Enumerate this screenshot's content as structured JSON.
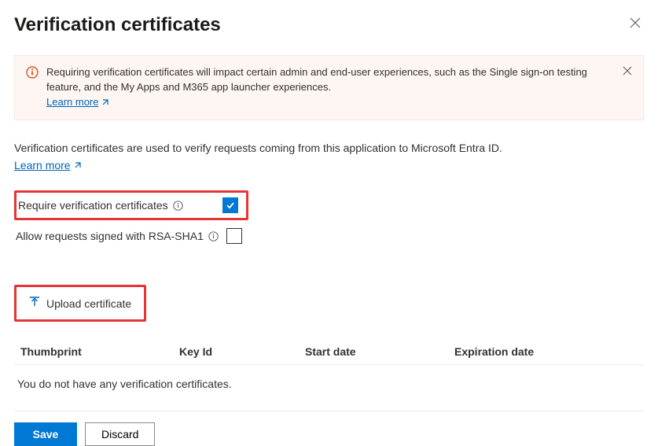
{
  "header": {
    "title": "Verification certificates"
  },
  "banner": {
    "message": "Requiring verification certificates will impact certain admin and end-user experiences, such as the Single sign-on testing feature, and the My Apps and M365 app launcher experiences.",
    "learn_more": "Learn more"
  },
  "description": {
    "text": "Verification certificates are used to verify requests coming from this application to Microsoft Entra ID.",
    "learn_more": "Learn more"
  },
  "options": {
    "require": {
      "label": "Require verification certificates",
      "checked": true
    },
    "allow_rsa": {
      "label": "Allow requests signed with RSA-SHA1",
      "checked": false
    }
  },
  "toolbar": {
    "upload": "Upload certificate"
  },
  "table": {
    "columns": {
      "thumbprint": "Thumbprint",
      "keyid": "Key Id",
      "start": "Start date",
      "expiration": "Expiration date"
    },
    "rows": [],
    "empty": "You do not have any verification certificates."
  },
  "footer": {
    "save": "Save",
    "discard": "Discard"
  }
}
